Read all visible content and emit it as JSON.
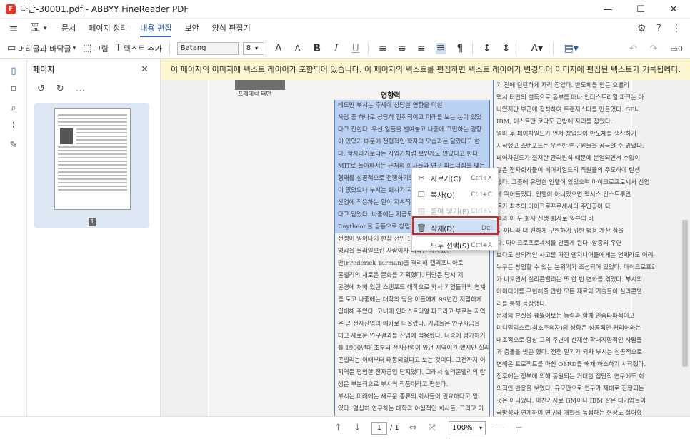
{
  "window": {
    "title": "다단-30001.pdf - ABBYY FineReader PDF",
    "app_icon_letter": "F",
    "controls": {
      "minimize": "—",
      "maximize": "☐",
      "close": "✕"
    }
  },
  "menu": {
    "items": [
      {
        "label": "문서"
      },
      {
        "label": "페이지 정리"
      },
      {
        "label": "내용 편집"
      },
      {
        "label": "보안"
      },
      {
        "label": "양식 편집기"
      }
    ],
    "active_index": 2
  },
  "toolbar": {
    "header_footer": "머리글과 바닥글",
    "image": "그림",
    "add_text": "텍스트 추가",
    "font_name": "Batang",
    "font_size": "8",
    "icon_labels": {
      "grow": "A",
      "shrink": "A",
      "bold": "B",
      "italic": "I",
      "underline": "U"
    },
    "colors": {
      "accent": "#2a5db0",
      "highlight": "#b9d1f2",
      "infobar": "#fdf6cf",
      "red_box": "#e0201f"
    }
  },
  "pages_panel": {
    "title": "페이지",
    "page_number": "1"
  },
  "infobar": {
    "message": "이 페이지의 이미지에 텍스트 레이어가 포함되어 있습니다. 이 페이지의 텍스트를 편집하면 텍스트 레이어가 변경되어 이미지에 편집된 텍스트가 기록됩니다."
  },
  "document": {
    "caption": "프레데릭 터만",
    "heading": "영향력",
    "col1_lines": [
      {
        "text": "테드만 부시는 후세에 상당한 영향을 미친",
        "hl": true
      },
      {
        "text": "사람 중 하나로 상당히 진취적이고 미래를 보는 눈이 있었",
        "hl": true
      },
      {
        "text": "다고 전한다. 우선 일들을 벌여놓고 나중에 고민하는 경향",
        "hl": true
      },
      {
        "text": "이 있었기 때문에 전형적인 학자의 모습과는 달랐다고 한",
        "hl": true
      },
      {
        "text": "다. 학자라기보다는 사업가처럼 보인게도 많았다고 한다.",
        "hl": true
      },
      {
        "text": "MIT로 돌아와서는 근처의 회사들과 연구 파트너십을 맺는",
        "hl": true
      },
      {
        "text": "형태를 성공적으로 전행하기도 했다. 당시에는 이례",
        "hl": true
      },
      {
        "text": "이 없었으나 부시는 회사가 자금을 대고 대학이",
        "hl": true
      },
      {
        "text": "산업에 적용하는 일이 지속적인 발전을 위해 반",
        "hl": true
      },
      {
        "text": "다고 믿었다. 나중에는 지금도 중요한 방위",
        "hl": true
      },
      {
        "text": "Raytheon을 공동으로 창업하기도 했다.",
        "hl": true
      },
      {
        "text": "전쟁이 일어나기 한참 전인 1920년대에 부",
        "hl": false
      },
      {
        "text": "영감을 불러일으킨 사람이자 대학원 제자였던",
        "hl": false
      },
      {
        "text": "만(Frederick Terman)을 격려해 캘리포니아로",
        "hl": false
      },
      {
        "text": "콘밸리의 새로운 문화를 기획했다. 터만은 당시 제",
        "hl": false
      },
      {
        "text": "곤경에 처해 있던 스탠포드 대학으로 와서 기업들과의 연계",
        "hl": false
      },
      {
        "text": "를 토고 나중에는 대학의 땅을 이들에게 99년간 저렴하게",
        "hl": false
      },
      {
        "text": "임대해 주었다. 고내에 인더스트리얼 파크라고 부르는 지역",
        "hl": false
      },
      {
        "text": "은 곧 전자산업의 메카로 떠올랐다. 기업들은 연구자금을",
        "hl": false
      },
      {
        "text": "대고 새로운 연구결과를 산업에 적용했다. 나중에 평가하기",
        "hl": false
      },
      {
        "text": "를 1900년대 초부터 전자산업이 있던 지역이긴 했지만 실리",
        "hl": false
      },
      {
        "text": "콘밸리는 이때부터 태동되었다고 보는 것이다. 그전까지 이",
        "hl": false
      },
      {
        "text": "지역은 평범한 전자공업 단지였다. 그래서 실리콘밸리의 탄",
        "hl": false
      },
      {
        "text": "생은 부분적으로 부시의 작품이라고 평한다.",
        "hl": false
      },
      {
        "text": "부시는 미래에는 새로운 종류의 회사들이 필요하다고 믿",
        "hl": false
      },
      {
        "text": "었다. 열심히 연구하는 대학과 야심적인 회사들, 그리고 이",
        "hl": false
      },
      {
        "text": "들의 독특한 아이템에 돈을 대는 모험적인 자본가들이 앞으",
        "hl": false
      },
      {
        "text": "로의 산업에 중요한 요소라고 보았기 때문이었다. 터만이",
        "hl": false
      }
    ],
    "col2_lines": [
      "기 전에 탄탄하게 자리 잡았다. 반도체를 만든 요밸리",
      "역시 터만의 설득으로 동부를 떠나 인더스트리얼 파크는 아",
      "나었지만 부근에 정착하여 트랜지스터를 만들었다. GE나",
      "IBM, 이스트만 코닥도 근방에 자리를 잡았다.",
      "얼마 후 페어차일드가 먼저 창업되어 반도체를 생산하기",
      "시작했고 스탠포드는 우수한 연구원들을 공급할 수 있었다.",
      "페어차일드가 철저한 관리원칙 때문에 분열되면서 수없이",
      "많은 전자회사들이 페어차일드의 직원들의 주도하에 탄생",
      "했다. 그중에 유명한 인텔이 있었으며 마이크로프로세서 산업",
      "에 뛰어들었다. 인텔이 아니었으면 멕시스 인스트루먼",
      "트가 최초의 마이크로프로세서의 주인공이 되",
      "결과 이 두 회사 신생 회사로 일본의 비",
      "지 아니라 더 편하게 구현하기 위한 범용 계산 칩을",
      "다. 마이크로프로세서를 만들게 된다. 앙종의 우연",
      "보다도 창의적인 사고를 가진 엔지니어들에게는 언제라도 어려운 일이 나",
      "누구든 창업할 수 있는 분위기가 조성되어 있었다. 마이크로프로세서",
      "가 나오면서 실리콘밸리는 또 한 번 변화를 겪었다. 부시의",
      "아이디어를 구현해줄 만한 모든 재료와 기술들이 실리콘밸",
      "리를 통해 등장했다.",
      "문제의 본질을 꿰뚫어보는 능력과 함께 인습타파적이고",
      "미니멀리스트(최소주의자)의 성향은 성공적인 커리어와는",
      "대조적으로 항상 그의 주변에 산재한 확대지향적인 사람들",
      "과 충돌을 빚곤 했다. 전쟁 말기가 되자 부시는 성공적으로",
      "변해온 프로젝트를 마친 OSRD를 해체 하소하기 시작했다.",
      "전후에는 정부에 의해 동원되는 거대한 집단적 연구에도 회",
      "의적인 반응을 보였다. 규모만으로 연구가 제대로 진행되는",
      "것은 아니었다. 마찬가지로 GM이나 IBM 같은 대기업들이",
      "국방성과 연계하여 연구와 개발을 독점하는 현상도 싫어했",
      "다고 한다. 팬표회가 설해지기 때문이었다.",
      "종전이 가까울 무렵 부시는 당시의 대통령인 트루먼에게"
    ]
  },
  "context_menu": {
    "items": [
      {
        "label": "자르기(C)",
        "shortcut": "Ctrl+X",
        "icon": "scissors-icon",
        "state": "normal"
      },
      {
        "label": "복사(O)",
        "shortcut": "Ctrl+C",
        "icon": "copy-icon",
        "state": "normal"
      },
      {
        "label": "붙여 넣기(P)",
        "shortcut": "Ctrl+V",
        "icon": "paste-icon",
        "state": "disabled"
      },
      {
        "label": "삭제(D)",
        "shortcut": "Del",
        "icon": "trash-icon",
        "state": "selected"
      },
      {
        "label": "모두 선택(S)",
        "shortcut": "Ctrl+A",
        "icon": "",
        "state": "normal"
      }
    ]
  },
  "bottombar": {
    "page_current": "1",
    "page_total": "/ 1",
    "zoom": "100%"
  }
}
